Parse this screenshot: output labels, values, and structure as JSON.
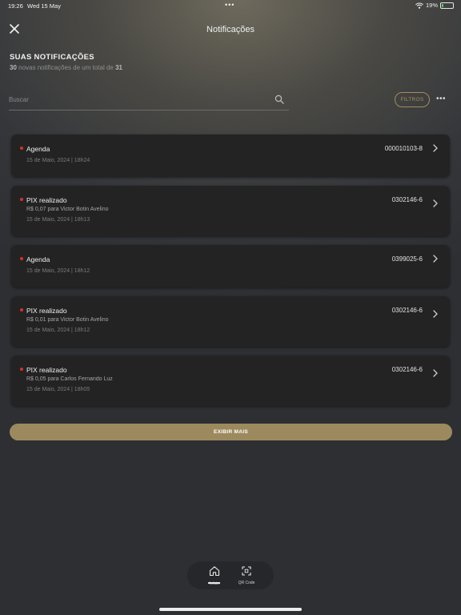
{
  "status_bar": {
    "time": "19:26",
    "date": "Wed 15 May",
    "battery": "19%",
    "battery_level": 0.19,
    "wifi_icon": "wifi-icon",
    "battery_icon": "battery-charging-icon"
  },
  "header": {
    "title": "Notificações",
    "close_icon": "close-icon"
  },
  "summary": {
    "title": "SUAS NOTIFICAÇÕES",
    "new_count": "30",
    "middle_text": " novas notificações de um total de ",
    "total_count": "31"
  },
  "search": {
    "placeholder": "Buscar",
    "value": "",
    "icon": "search-icon"
  },
  "filters": {
    "label": "FILTROS",
    "more_icon": "more-dots-icon"
  },
  "notifications": [
    {
      "title": "Agenda",
      "code": "000010103-8",
      "description": "",
      "date": "15 de Maio, 2024 | 18h24",
      "unread": true
    },
    {
      "title": "PIX realizado",
      "code": "0302146-6",
      "description": "R$ 0,07 para Victor Botin Avelino",
      "date": "15 de Maio, 2024 | 18h13",
      "unread": true
    },
    {
      "title": "Agenda",
      "code": "0399025-6",
      "description": "",
      "date": "15 de Maio, 2024 | 18h12",
      "unread": true
    },
    {
      "title": "PIX realizado",
      "code": "0302146-6",
      "description": "R$ 0,01 para Victor Botin Avelino",
      "date": "15 de Maio, 2024 | 18h12",
      "unread": true
    },
    {
      "title": "PIX realizado",
      "code": "0302146-6",
      "description": "R$ 0,05 para Carlos Fernando Luz",
      "date": "15 de Maio, 2024 | 18h05",
      "unread": true
    }
  ],
  "show_more": {
    "label": "EXIBIR MAIS"
  },
  "tabbar": {
    "items": [
      {
        "label": "Início",
        "icon": "home-icon",
        "active": true
      },
      {
        "label": "QR Code",
        "icon": "qr-scan-icon",
        "active": false
      }
    ]
  },
  "colors": {
    "accent_gold": "#9c8a5e",
    "unread_dot": "#d9302a",
    "card_bg": "#232324"
  }
}
